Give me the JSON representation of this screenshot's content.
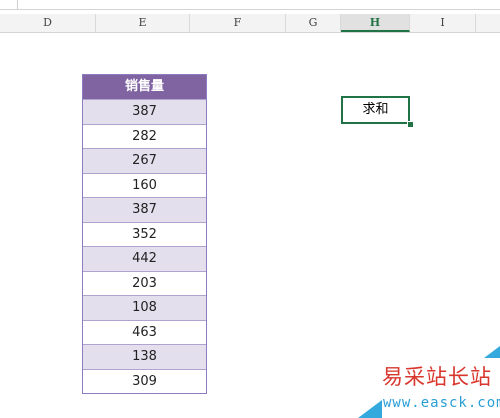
{
  "spreadsheet": {
    "columns": [
      "D",
      "E",
      "F",
      "G",
      "H",
      "I"
    ],
    "selected_column": "H",
    "table": {
      "header": "销售量",
      "values": [
        387,
        282,
        267,
        160,
        387,
        352,
        442,
        203,
        108,
        463,
        138,
        309
      ]
    },
    "active_cell": {
      "text": "求和"
    }
  },
  "watermark": {
    "title": "易采站长站",
    "url": "www.easck.com"
  },
  "colors": {
    "table_header_bg": "#8064a2",
    "table_odd_row_bg": "#e4dfec",
    "selection_green": "#217346",
    "watermark_red": "#d9362d",
    "watermark_blue": "#2a9fd6"
  }
}
